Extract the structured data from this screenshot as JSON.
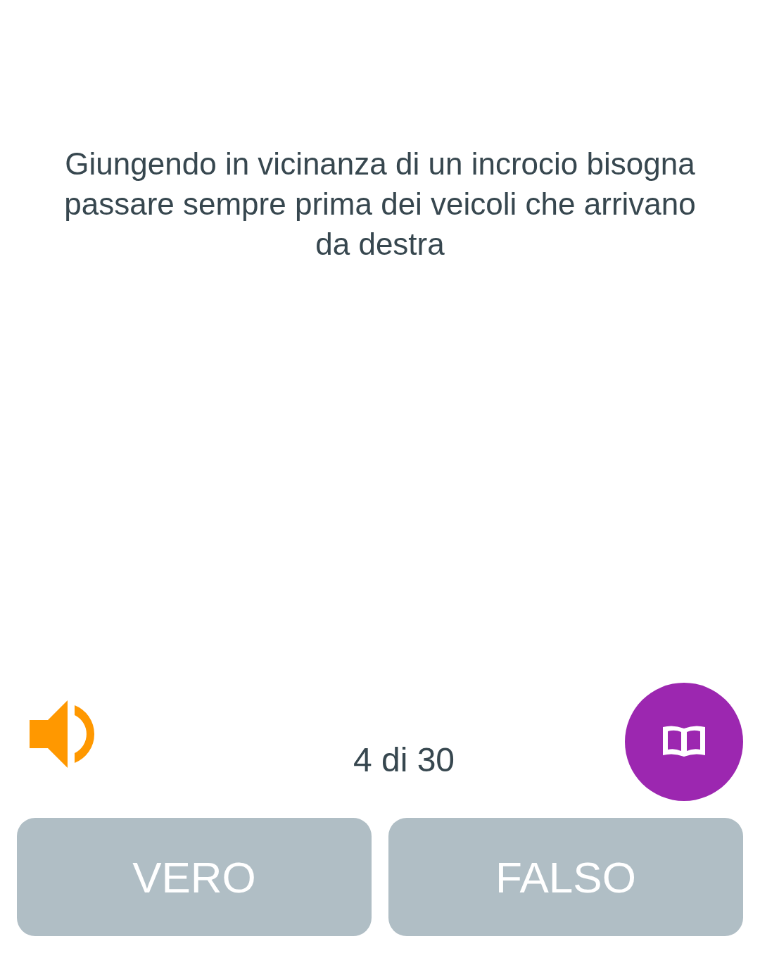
{
  "question": {
    "text": "Giungendo in vicinanza di un incrocio bisogna passare sempre prima dei veicoli che arrivano da destra"
  },
  "counter": "4 di 30",
  "answers": [
    {
      "label": "VERO"
    },
    {
      "label": "FALSO"
    }
  ]
}
